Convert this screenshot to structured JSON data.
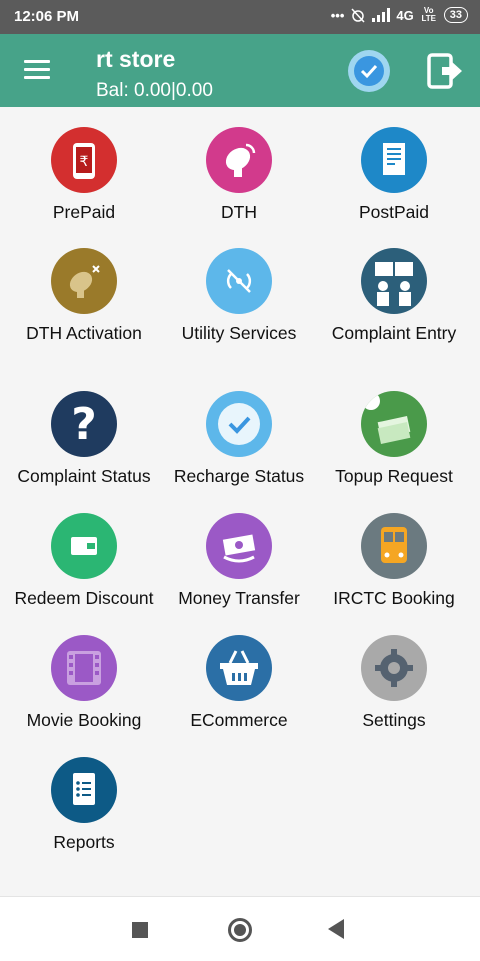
{
  "status_bar": {
    "time": "12:06 PM",
    "network": "4G",
    "volte": "Vo LTE",
    "battery": "33"
  },
  "header": {
    "store_name": "rt store",
    "balance": "Bal: 0.00|0.00"
  },
  "tiles": [
    {
      "label": "PrePaid",
      "icon": "prepaid-mobile-icon",
      "color": "#d32f2f"
    },
    {
      "label": "DTH",
      "icon": "satellite-dish-icon",
      "color": "#d23a8c"
    },
    {
      "label": "PostPaid",
      "icon": "bill-document-icon",
      "color": "#1e88c8"
    },
    {
      "label": "DTH Activation",
      "icon": "dish-activation-icon",
      "color": "#9a7a2a"
    },
    {
      "label": "Utility Services",
      "icon": "utility-signal-icon",
      "color": "#5db7ea"
    },
    {
      "label": "Complaint Entry",
      "icon": "complaint-people-icon",
      "color": "#2c5f7a"
    },
    {
      "label": "Complaint Status",
      "icon": "question-mark-icon",
      "color": "#1f3b5f"
    },
    {
      "label": "Recharge Status",
      "icon": "check-circle-icon",
      "color": "#5db7ea"
    },
    {
      "label": "Topup Request",
      "icon": "money-stack-icon",
      "color": "#4a9a4a"
    },
    {
      "label": "Redeem Discount",
      "icon": "wallet-icon",
      "color": "#2bb673"
    },
    {
      "label": "Money Transfer",
      "icon": "money-transfer-icon",
      "color": "#9b59c6"
    },
    {
      "label": "IRCTC Booking",
      "icon": "train-icon",
      "color": "#6b7a80"
    },
    {
      "label": "Movie Booking",
      "icon": "film-strip-icon",
      "color": "#9b59c6"
    },
    {
      "label": "ECommerce",
      "icon": "shopping-basket-icon",
      "color": "#2b6fa6"
    },
    {
      "label": "Settings",
      "icon": "gear-icon",
      "color": "#a9a9a9"
    },
    {
      "label": "Reports",
      "icon": "report-list-icon",
      "color": "#0d5a86"
    }
  ]
}
